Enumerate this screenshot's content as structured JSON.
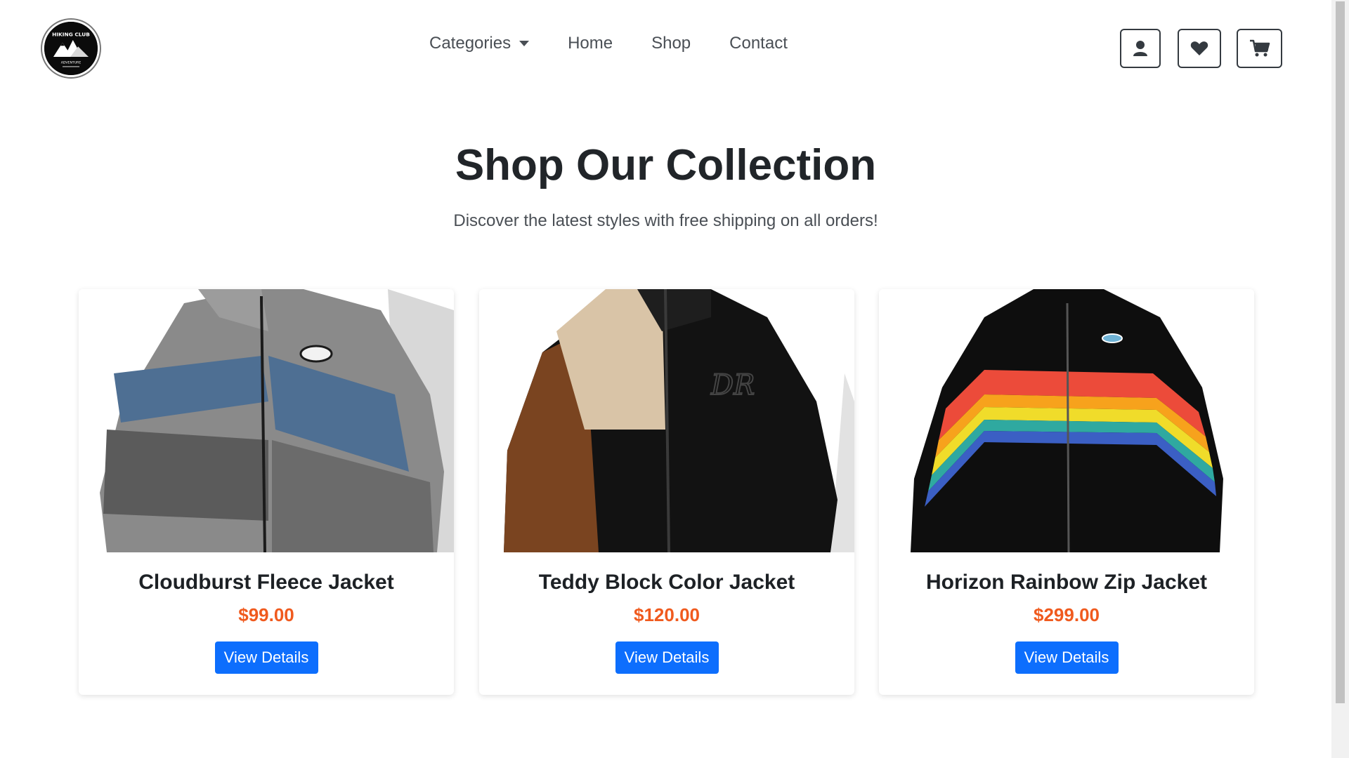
{
  "nav": {
    "logo_text": "HIKING CLUB",
    "logo_subtext": "ADVENTURE",
    "links": [
      "Categories",
      "Home",
      "Shop",
      "Contact"
    ],
    "icons": [
      "user-icon",
      "heart-icon",
      "cart-icon"
    ]
  },
  "hero": {
    "title": "Shop Our Collection",
    "subtitle": "Discover the latest styles with free shipping on all orders!"
  },
  "products": [
    {
      "name": "Cloudburst Fleece Jacket",
      "price": "$99.00",
      "button": "View Details"
    },
    {
      "name": "Teddy Block Color Jacket",
      "price": "$120.00",
      "button": "View Details"
    },
    {
      "name": "Horizon Rainbow Zip Jacket",
      "price": "$299.00",
      "button": "View Details"
    }
  ],
  "colors": {
    "accent": "#0d6efd",
    "price": "#f05a1e",
    "text": "#212529"
  }
}
